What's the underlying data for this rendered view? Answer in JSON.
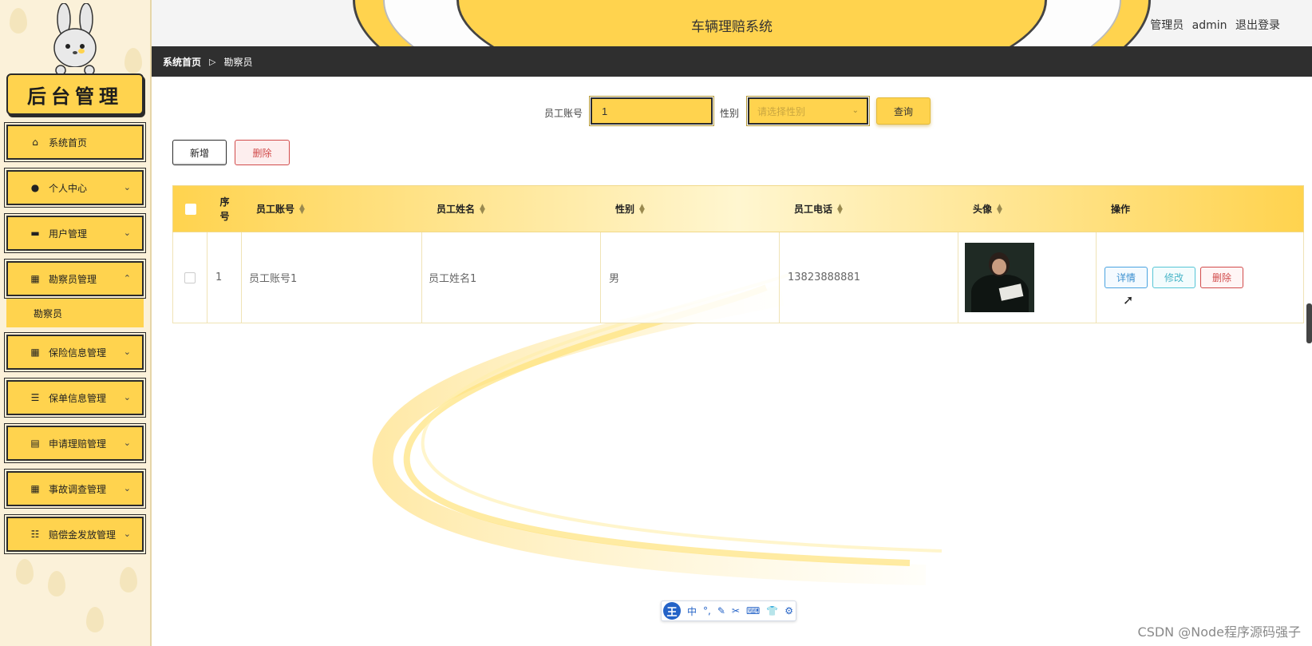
{
  "sidebar": {
    "brand": "后台管理",
    "items": [
      {
        "label": "系统首页",
        "icon": "home-icon",
        "glyph": "⌂",
        "chevron": ""
      },
      {
        "label": "个人中心",
        "icon": "user-icon",
        "glyph": "●",
        "chevron": "⌄"
      },
      {
        "label": "用户管理",
        "icon": "briefcase-icon",
        "glyph": "▬",
        "chevron": "⌄"
      },
      {
        "label": "勘察员管理",
        "icon": "grid-icon",
        "glyph": "▦",
        "chevron": "⌃"
      },
      {
        "label": "保险信息管理",
        "icon": "grid-icon",
        "glyph": "▦",
        "chevron": "⌄"
      },
      {
        "label": "保单信息管理",
        "icon": "list-icon",
        "glyph": "☰",
        "chevron": "⌄"
      },
      {
        "label": "申请理赔管理",
        "icon": "printer-icon",
        "glyph": "▤",
        "chevron": "⌄"
      },
      {
        "label": "事故调查管理",
        "icon": "grid-icon",
        "glyph": "▦",
        "chevron": "⌄"
      },
      {
        "label": "赔偿金发放管理",
        "icon": "sliders-icon",
        "glyph": "☷",
        "chevron": "⌄"
      }
    ],
    "active_sub": "勘察员"
  },
  "header": {
    "title": "车辆理赔系统",
    "user_role": "管理员",
    "user_name": "admin",
    "logout": "退出登录"
  },
  "breadcrumb": {
    "home": "系统首页",
    "separator": "▷",
    "current": "勘察员"
  },
  "search": {
    "account_label": "员工账号",
    "account_value": "1",
    "gender_label": "性别",
    "gender_placeholder": "请选择性别",
    "query_button": "查询"
  },
  "actions": {
    "add": "新增",
    "delete": "删除"
  },
  "table": {
    "columns": [
      "序号",
      "员工账号",
      "员工姓名",
      "性别",
      "员工电话",
      "头像",
      "操作"
    ],
    "index_header_line1": "序",
    "index_header_line2": "号",
    "rows": [
      {
        "index": "1",
        "account": "员工账号1",
        "name": "员工姓名1",
        "gender": "男",
        "phone": "13823888881",
        "ops": {
          "detail": "详情",
          "edit": "修改",
          "delete": "删除"
        }
      }
    ]
  },
  "ime": {
    "logo": "王",
    "mode": "中",
    "tools": [
      "°,",
      "✎",
      "✂",
      "⌨",
      "👕",
      "⚙"
    ]
  },
  "watermark": "CSDN @Node程序源码强子",
  "colors": {
    "accent": "#ffd34e",
    "dark": "#2f2f2f",
    "danger": "#d14b4b",
    "info": "#3a8fd0"
  }
}
